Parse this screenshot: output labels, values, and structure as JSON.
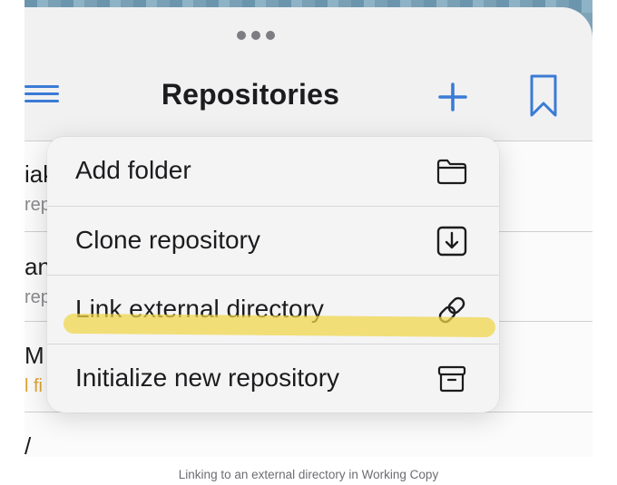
{
  "navbar": {
    "title": "Repositories",
    "icons": [
      "hamburger-menu-icon",
      "plus-icon",
      "bookmark-icon"
    ]
  },
  "background_list": {
    "fragments": [
      "iak",
      "rep",
      "an",
      "rep",
      "M",
      "l fi",
      "/"
    ]
  },
  "context_menu": {
    "items": [
      {
        "label": "Add folder",
        "icon": "folder-icon"
      },
      {
        "label": "Clone repository",
        "icon": "download-box-icon"
      },
      {
        "label": "Link external directory",
        "icon": "link-icon"
      },
      {
        "label": "Initialize new repository",
        "icon": "archive-box-icon"
      }
    ]
  },
  "caption": "Linking to an external directory in Working Copy",
  "colors": {
    "accent": "#3a7bd5",
    "highlight": "#f0d646",
    "orange_text": "#e0a32a"
  }
}
